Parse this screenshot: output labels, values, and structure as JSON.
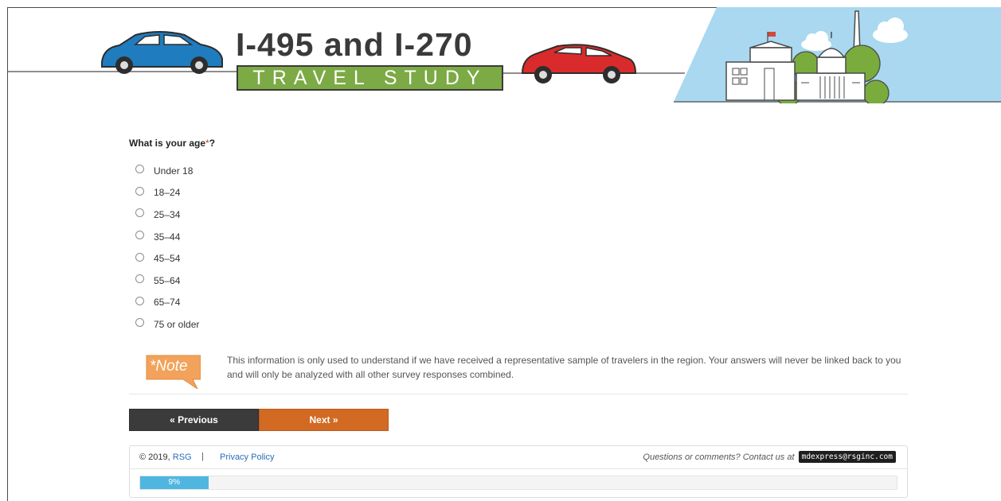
{
  "header": {
    "title_line1": "I-495 and I-270",
    "title_line2": "TRAVEL STUDY"
  },
  "question": {
    "text": "What is your age",
    "required_mark": "*",
    "suffix": "?"
  },
  "options": [
    "Under 18",
    "18–24",
    "25–34",
    "35–44",
    "45–54",
    "55–64",
    "65–74",
    "75 or older"
  ],
  "note": {
    "badge": "*Note",
    "text": "This information is only used to understand if we have received a representative sample of travelers in the region. Your answers will never be linked back to you and will only be analyzed with all other survey responses combined."
  },
  "nav": {
    "previous_label": "« Previous",
    "next_label": "Next »"
  },
  "footer": {
    "copyright": "© 2019,",
    "company_link": "RSG",
    "separator": "|",
    "privacy_link": "Privacy Policy",
    "contact_text": "Questions or comments? Contact us at",
    "email": "mdexpress@rsginc.com"
  },
  "progress": {
    "label": "9%",
    "fraction": 0.09
  },
  "colors": {
    "accent_green": "#7caa44",
    "next_button": "#d26a24",
    "previous_button": "#3b3b3b",
    "progress": "#4fb6e0",
    "link": "#2a6fb7"
  }
}
